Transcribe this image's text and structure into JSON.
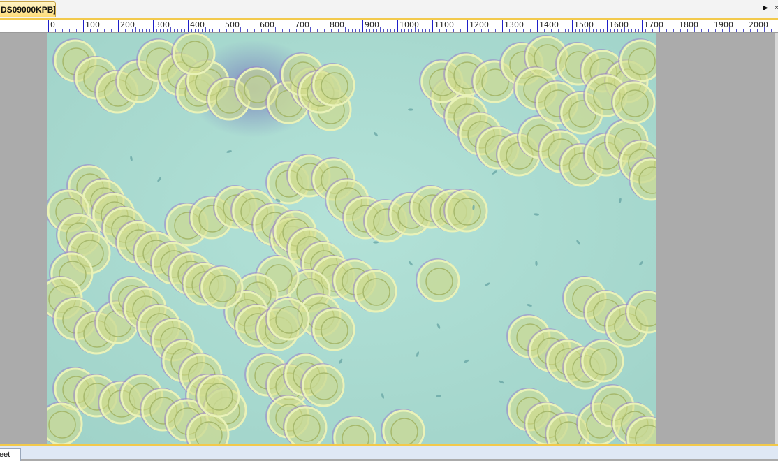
{
  "tab": {
    "title": "DS09000KPB]"
  },
  "ruler": {
    "labels": [
      "0",
      "100",
      "200",
      "300",
      "400",
      "500",
      "600",
      "700",
      "800",
      "900",
      "1000",
      "1100",
      "1200",
      "1300",
      "1400",
      "1500",
      "1600",
      "1700",
      "1800",
      "1900",
      "2000"
    ]
  },
  "nav": {
    "right": "▶",
    "close": "×"
  },
  "image": {
    "subject": "red blood cells micrograph"
  },
  "bottom": {
    "sheet_tab": "eet"
  },
  "colors": {
    "background": "#ababab",
    "tab_gold": "#ffdd7a",
    "ruler_blue": "#1e1ec8",
    "micrograph_base": "#a9dcd2"
  }
}
